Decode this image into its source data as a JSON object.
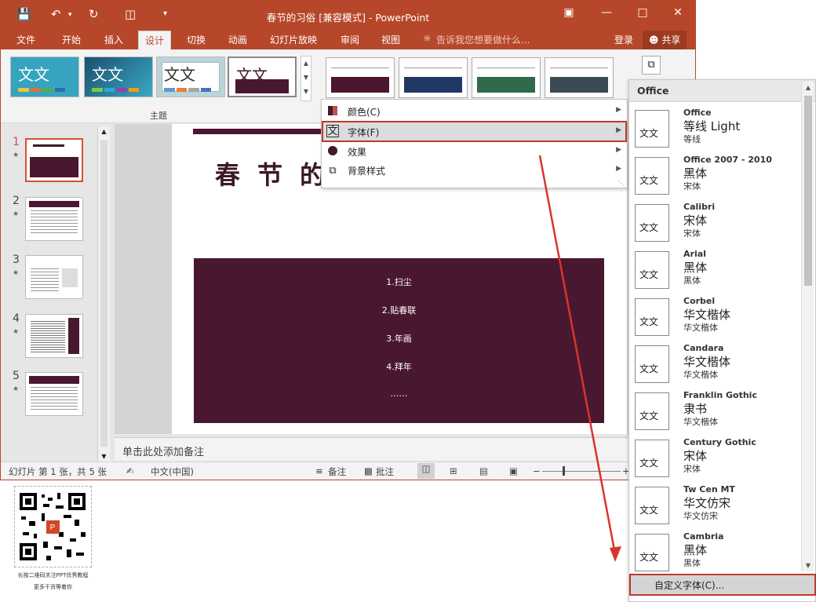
{
  "titlebar": {
    "title": "春节的习俗 [兼容模式] - PowerPoint",
    "qat": [
      "save-icon",
      "undo-icon",
      "redo-icon",
      "present-icon",
      "qat-more-icon"
    ],
    "controls": [
      "restore-ribbon-icon",
      "minimize-icon",
      "maximize-icon",
      "close-icon"
    ]
  },
  "tabs": [
    "文件",
    "开始",
    "插入",
    "设计",
    "切换",
    "动画",
    "幻灯片放映",
    "审阅",
    "视图"
  ],
  "active_tab": "设计",
  "tellme": "告诉我您想要做什么...",
  "login": "登录",
  "share": "共享",
  "ribbon": {
    "themes_group_label": "主题",
    "theme_sample_text": "文文",
    "variants_colors": [
      "#4a1730",
      "#1f3864",
      "#2e6b4b",
      "#3b4a52"
    ]
  },
  "variants_menu": [
    {
      "label": "颜色(C)",
      "icon": "colors-icon"
    },
    {
      "label": "字体(F)",
      "icon": "fonts-icon"
    },
    {
      "label": "效果",
      "icon": "effects-icon"
    },
    {
      "label": "背景样式",
      "icon": "background-style-icon"
    }
  ],
  "slides": [
    {
      "num": "1"
    },
    {
      "num": "2"
    },
    {
      "num": "3"
    },
    {
      "num": "4"
    },
    {
      "num": "5"
    }
  ],
  "slide": {
    "heading": "春节",
    "heading_tail": "的",
    "items": [
      "1.扫尘",
      "2.贴春联",
      "3.年画",
      "4.拜年",
      "……"
    ]
  },
  "notes_placeholder": "单击此处添加备注",
  "status": {
    "slide_info": "幻灯片 第 1 张，共 5 张",
    "language": "中文(中国)",
    "notes": "备注",
    "comments": "批注"
  },
  "font_panel": {
    "header": "Office",
    "preview_text": "文文",
    "fonts": [
      {
        "name": "Office",
        "heading": "等线 Light",
        "body": "等线"
      },
      {
        "name": "Office 2007 - 2010",
        "heading": "黑体",
        "body": "宋体"
      },
      {
        "name": "Calibri",
        "heading": "宋体",
        "body": "宋体"
      },
      {
        "name": "Arial",
        "heading": "黑体",
        "body": "黑体"
      },
      {
        "name": "Corbel",
        "heading": "华文楷体",
        "body": "华文楷体"
      },
      {
        "name": "Candara",
        "heading": "华文楷体",
        "body": "华文楷体"
      },
      {
        "name": "Franklin Gothic",
        "heading": "隶书",
        "body": "华文楷体"
      },
      {
        "name": "Century Gothic",
        "heading": "宋体",
        "body": "宋体"
      },
      {
        "name": "Tw Cen MT",
        "heading": "华文仿宋",
        "body": "华文仿宋"
      },
      {
        "name": "Cambria",
        "heading": "黑体",
        "body": "黑体"
      }
    ],
    "custom_label": "自定义字体(C)..."
  },
  "qr": {
    "caption1": "长按二维码关注PPT优秀教程",
    "caption2": "更多干货等着你"
  },
  "colors": {
    "accent": "#b7472a",
    "slide_band": "#4a1730",
    "highlight": "#c0392b"
  }
}
